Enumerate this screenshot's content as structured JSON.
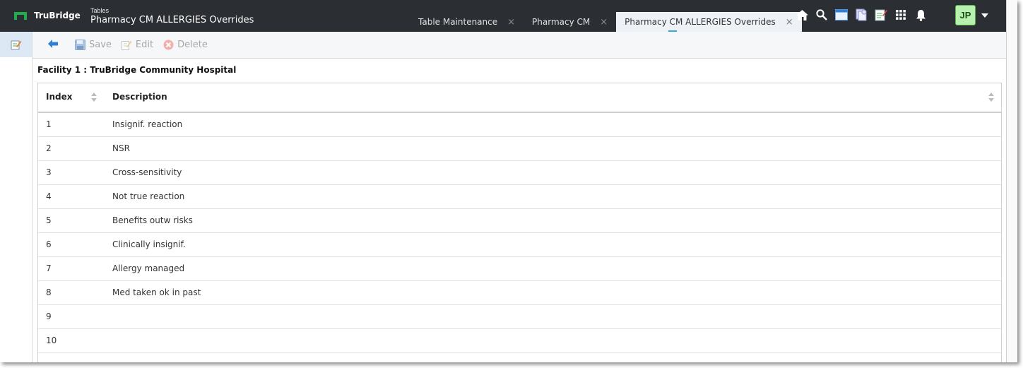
{
  "header": {
    "brand": "TruBridge",
    "breadcrumb_small": "Tables",
    "breadcrumb_title": "Pharmacy CM ALLERGIES Overrides",
    "tabs": [
      {
        "label": "Table Maintenance",
        "active": false
      },
      {
        "label": "Pharmacy CM",
        "active": false
      },
      {
        "label": "Pharmacy CM ALLERGIES Overrides",
        "active": true
      }
    ],
    "close_glyph": "×",
    "icons": [
      "home-icon",
      "search-icon",
      "window-icon",
      "documents-icon",
      "notes-icon",
      "apps-grid-icon",
      "bell-icon"
    ],
    "user_initials": "JP",
    "brand_color": "#1fae4b",
    "header_bg": "#2b2e33"
  },
  "toolbar": {
    "save_label": "Save",
    "edit_label": "Edit",
    "delete_label": "Delete"
  },
  "content": {
    "facility_label": "Facility 1 : TruBridge Community Hospital",
    "columns": [
      "Index",
      "Description"
    ],
    "rows": [
      {
        "index": "1",
        "description": "Insignif. reaction"
      },
      {
        "index": "2",
        "description": "NSR"
      },
      {
        "index": "3",
        "description": "Cross-sensitivity"
      },
      {
        "index": "4",
        "description": "Not true reaction"
      },
      {
        "index": "5",
        "description": "Benefits outw risks"
      },
      {
        "index": "6",
        "description": "Clinically insignif."
      },
      {
        "index": "7",
        "description": "Allergy managed"
      },
      {
        "index": "8",
        "description": "Med taken ok in past"
      },
      {
        "index": "9",
        "description": ""
      },
      {
        "index": "10",
        "description": ""
      }
    ]
  }
}
